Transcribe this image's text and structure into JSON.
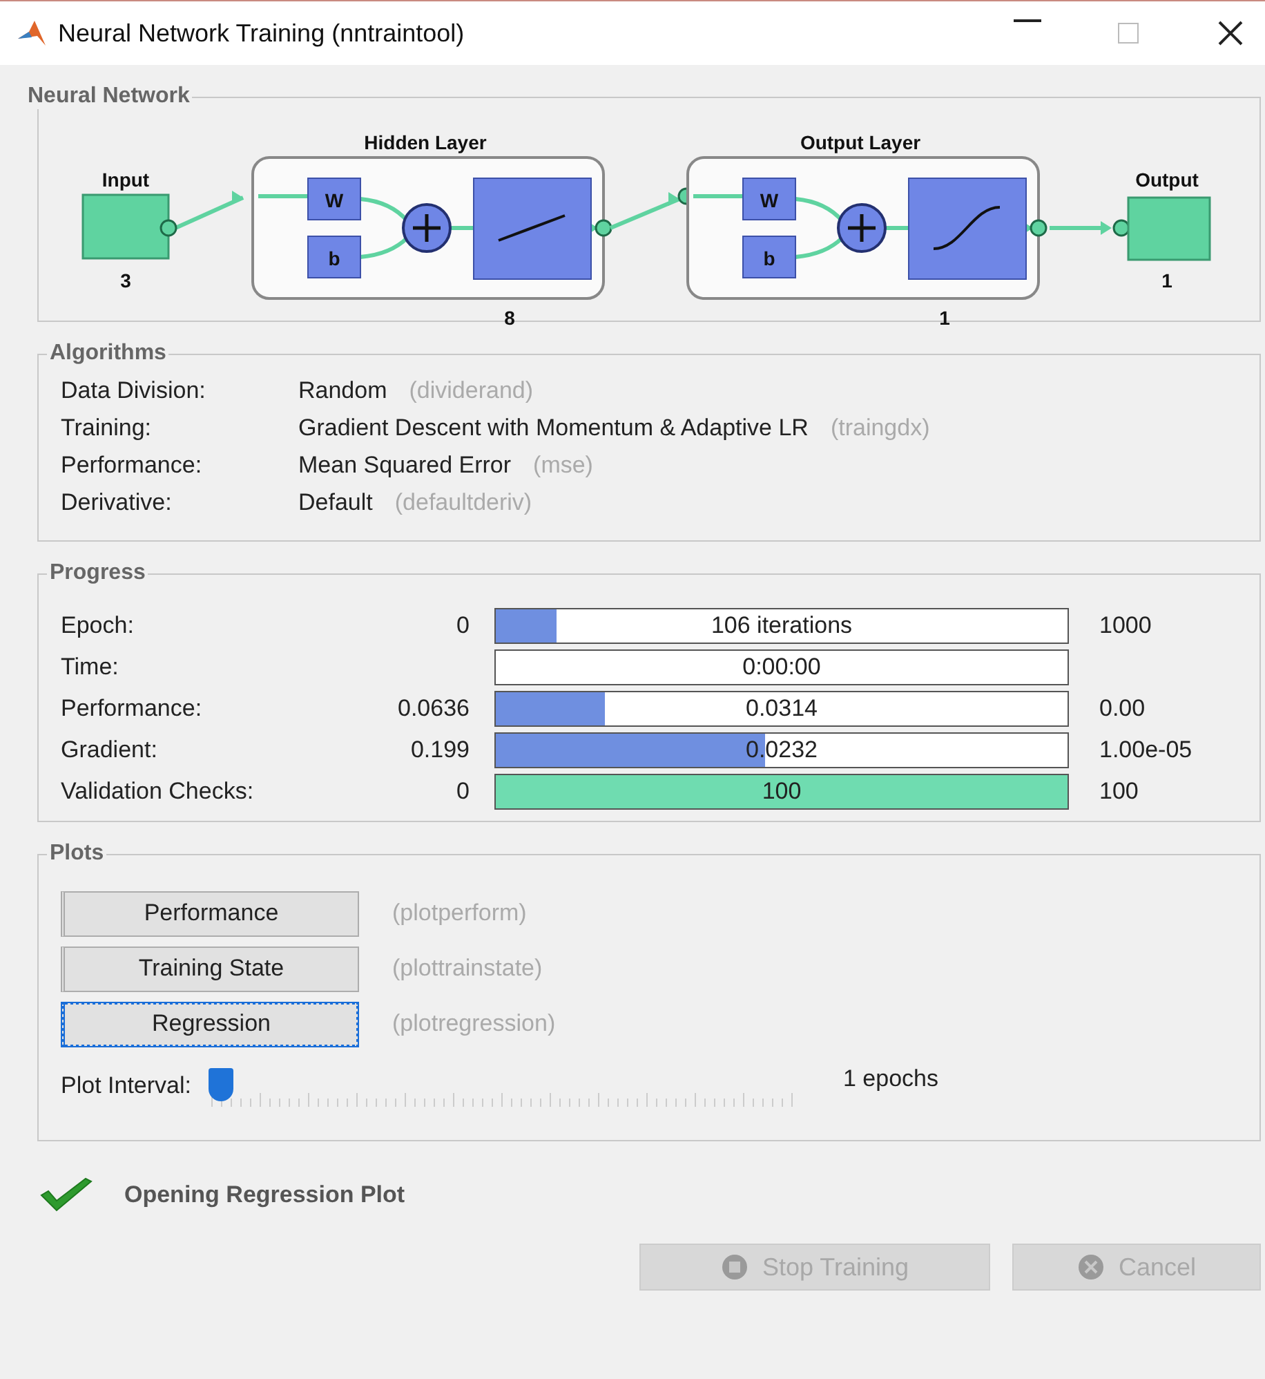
{
  "window": {
    "title": "Neural Network Training (nntraintool)"
  },
  "network": {
    "title": "Neural Network",
    "input": {
      "label": "Input",
      "size": "3"
    },
    "layers": [
      {
        "title": "Hidden Layer",
        "weight": "W",
        "bias": "b",
        "size": "8",
        "kind": "linear"
      },
      {
        "title": "Output Layer",
        "weight": "W",
        "bias": "b",
        "size": "1",
        "kind": "sigmoid"
      }
    ],
    "output": {
      "label": "Output",
      "size": "1"
    }
  },
  "algorithms": {
    "title": "Algorithms",
    "rows": [
      {
        "label": "Data Division:",
        "value": "Random",
        "function": "(dividerand)"
      },
      {
        "label": "Training:",
        "value": "Gradient Descent with Momentum & Adaptive LR",
        "function": "(traingdx)"
      },
      {
        "label": "Performance:",
        "value": "Mean Squared Error",
        "function": "(mse)"
      },
      {
        "label": "Derivative:",
        "value": "Default",
        "function": "(defaultderiv)"
      }
    ]
  },
  "progress": {
    "title": "Progress",
    "rows": [
      {
        "label": "Epoch:",
        "start": "0",
        "bar_text": "106 iterations",
        "end": "1000",
        "level": 0.106,
        "color": "#6f8fe0"
      },
      {
        "label": "Time:",
        "bar_text": "0:00:00",
        "level": 0
      },
      {
        "label": "Performance:",
        "start": "0.0636",
        "bar_text": "0.0314",
        "end": "0.00",
        "level": 0.19,
        "color": "#6f8fe0"
      },
      {
        "label": "Gradient:",
        "start": "0.199",
        "bar_text": "0.0232",
        "end": "1.00e-05",
        "level": 0.47,
        "color": "#6f8fe0"
      },
      {
        "label": "Validation Checks:",
        "start": "0",
        "bar_text": "100",
        "end": "100",
        "level": 1,
        "color": "#6fdcb0"
      }
    ]
  },
  "plots": {
    "title": "Plots",
    "buttons": [
      {
        "label": "Performance",
        "function": "(plotperform)",
        "focused": false
      },
      {
        "label": "Training State",
        "function": "(plottrainstate)",
        "focused": false
      },
      {
        "label": "Regression",
        "function": "(plotregression)",
        "focused": true
      }
    ],
    "interval": {
      "label": "Plot Interval:",
      "level": 0,
      "reading": "1 epochs"
    }
  },
  "status": {
    "text": "Opening Regression Plot"
  },
  "buttons": [
    {
      "label": "Stop Training",
      "kind": "stop",
      "disabled": true
    },
    {
      "label": "Cancel",
      "kind": "cancel",
      "disabled": true
    }
  ]
}
